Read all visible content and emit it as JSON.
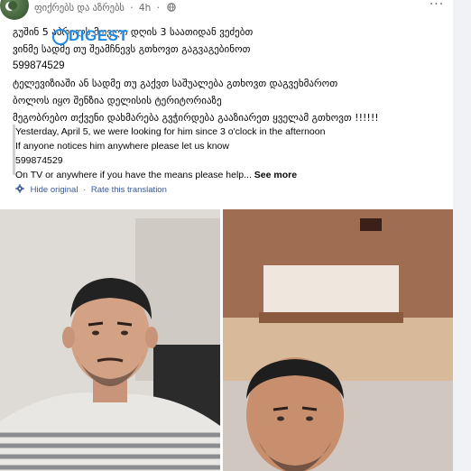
{
  "header": {
    "page_name": "ფიქრებს და აზრებს",
    "separator": "·",
    "time": "4h",
    "more_label": "···"
  },
  "post": {
    "original_lines": [
      "გუშინ 5 აპრილს მთელი დღის 3 საათიდან ვეძებთ",
      "ვინმე სადმე თუ შეამჩნევს გთხოვთ გაგვაგებინოთ",
      "599874529",
      "ტელევიზიაში ან სადმე თუ გაქვთ საშუალება გთხოვთ დაგვეხმაროთ",
      "ბოლოს იყო შენზია დელისის ტერიტორიაზე",
      "მეგობრებო თქვენი დახმარება გვჭირდება გააზიარეთ ყველამ გთხოვთ !!!!!!"
    ],
    "watermark": "DIGEST",
    "translation_lines": [
      "Yesterday, April 5, we were looking for him since 3 o'clock in the afternoon",
      "If anyone notices him anywhere please let us know",
      "599874529",
      "On TV or anywhere if you have the means please help..."
    ],
    "see_more": "See more",
    "hide_original": "Hide original",
    "link_separator": "·",
    "rate_translation": "Rate this translation"
  },
  "colors": {
    "link": "#385898",
    "meta_text": "#65676b",
    "body_text": "#050505",
    "watermark": "#1e88e5"
  }
}
